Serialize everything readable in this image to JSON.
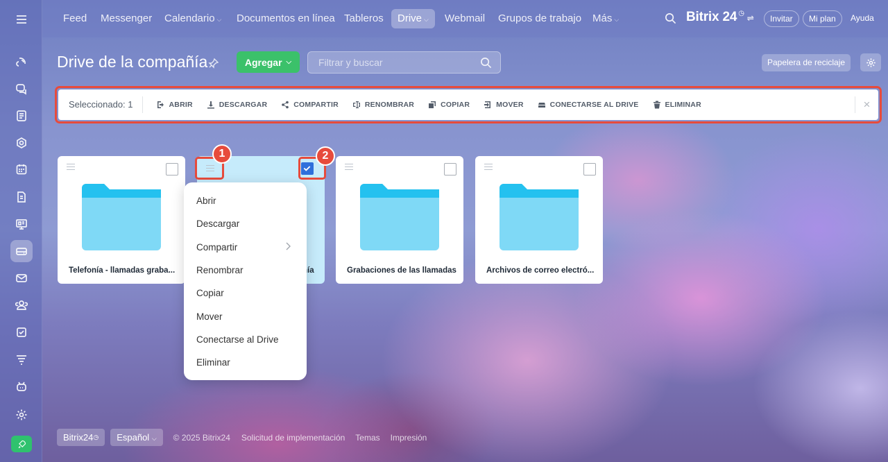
{
  "topnav": {
    "items": [
      "Feed",
      "Messenger",
      "Calendario",
      "Documentos en línea",
      "Tableros",
      "Drive",
      "Webmail",
      "Grupos de trabajo",
      "Más"
    ],
    "active": "Drive",
    "brand": "Bitrix 24",
    "invite": "Invitar",
    "plan": "Mi plan",
    "help": "Ayuda"
  },
  "sidebar": {
    "icons": [
      "feed-icon",
      "chat-icon",
      "tasks-icon",
      "groups-icon",
      "calendar-icon",
      "documents-icon",
      "boards-icon",
      "drive-icon",
      "mail-icon",
      "contacts-icon",
      "checklist-icon",
      "filter-icon",
      "robot-icon",
      "settings-icon",
      "rocket-icon"
    ],
    "active": "drive-icon"
  },
  "page": {
    "title": "Drive de la compañía",
    "add_label": "Agregar",
    "search_placeholder": "Filtrar y buscar",
    "trash_label": "Papelera de reciclaje"
  },
  "actionbar": {
    "selected": "Seleccionado: 1",
    "actions": [
      "ABRIR",
      "DESCARGAR",
      "COMPARTIR",
      "RENOMBRAR",
      "COPIAR",
      "MOVER",
      "CONECTARSE AL DRIVE",
      "ELIMINAR"
    ],
    "close": "×"
  },
  "folders": [
    {
      "name": "Telefonía - llamadas graba...",
      "checked": false
    },
    {
      "name": "ñía",
      "checked": true
    },
    {
      "name": "Grabaciones de las llamadas",
      "checked": false
    },
    {
      "name": "Archivos de correo electró...",
      "checked": false
    }
  ],
  "context_menu": {
    "items": [
      "Abrir",
      "Descargar",
      "Compartir",
      "Renombrar",
      "Copiar",
      "Mover",
      "Conectarse al Drive",
      "Eliminar"
    ]
  },
  "annotations": {
    "badge1": "1",
    "badge2": "2"
  },
  "footer": {
    "brand": "Bitrix24",
    "language": "Español",
    "copyright": "© 2025 Bitrix24",
    "implementation": "Solicitud de implementación",
    "themes": "Temas",
    "print": "Impresión"
  },
  "colors": {
    "accent_green": "#3bc16a",
    "highlight_red": "#e74b3c",
    "folder_blue": "#7fd9f6",
    "folder_tab": "#24c1ef",
    "checkbox_blue": "#2e6fdb"
  }
}
